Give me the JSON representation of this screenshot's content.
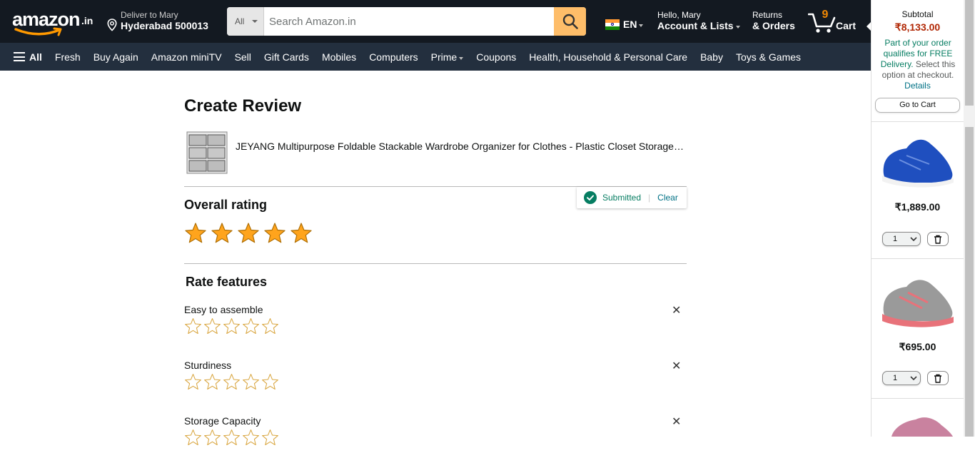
{
  "header": {
    "logo_text": "amazon",
    "logo_tld": ".in",
    "deliver_line1": "Deliver to Mary",
    "deliver_line2": "Hyderabad 500013",
    "search_category": "All",
    "search_placeholder": "Search Amazon.in",
    "language": "EN",
    "account_line1": "Hello, Mary",
    "account_line2": "Account & Lists",
    "returns_line1": "Returns",
    "returns_line2": "& Orders",
    "cart_count": "9",
    "cart_label": "Cart"
  },
  "nav": {
    "all_label": "All",
    "items": [
      "Fresh",
      "Buy Again",
      "Amazon miniTV",
      "Sell",
      "Gift Cards",
      "Mobiles",
      "Computers",
      "Prime",
      "Coupons",
      "Health, Household & Personal Care",
      "Baby",
      "Toys & Games"
    ]
  },
  "review": {
    "page_title": "Create Review",
    "product_title": "JEYANG Multipurpose Foldable Stackable Wardrobe Organizer for Clothes - Plastic Closet Storage Box with Doors",
    "status_text": "Submitted",
    "clear_label": "Clear",
    "overall_heading": "Overall rating",
    "overall_rating": 5,
    "overall_max": 5,
    "features_heading": "Rate features",
    "features": [
      {
        "label": "Easy to assemble",
        "rating": 0
      },
      {
        "label": "Sturdiness",
        "rating": 0
      },
      {
        "label": "Storage Capacity",
        "rating": 0
      }
    ]
  },
  "cart_panel": {
    "subtotal_label": "Subtotal",
    "subtotal_amount": "₹8,133.00",
    "free_delivery_note": "Part of your order qualifies for FREE Delivery.",
    "free_delivery_note2": "Select this option at checkout.",
    "details_link": "Details",
    "goto_cart_label": "Go to Cart",
    "items": [
      {
        "price": "₹1,889.00",
        "qty": "1",
        "color": "#1f4fbf"
      },
      {
        "price": "₹695.00",
        "qty": "1",
        "color": "#9a9a9a"
      }
    ]
  },
  "colors": {
    "header_bg": "#131921",
    "nav_bg": "#232f3e",
    "search_button": "#febd69",
    "star_fill": "#ffa41c",
    "price_red": "#b12704",
    "success_green": "#067d62",
    "link": "#007185"
  }
}
